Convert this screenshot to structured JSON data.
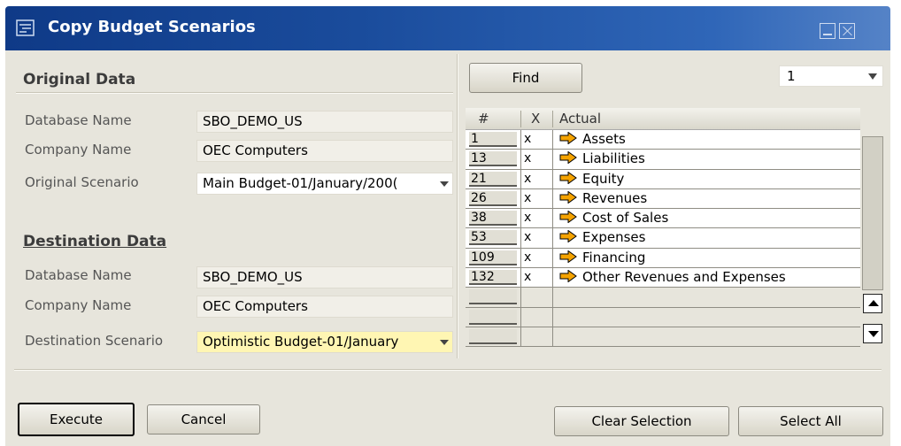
{
  "window": {
    "title": "Copy Budget Scenarios",
    "colors": {
      "titlebar": "#1a4c9c",
      "panel": "#e7e5dc",
      "highlight_field": "#fff6b3"
    }
  },
  "original": {
    "section_title": "Original Data",
    "database_label": "Database Name",
    "database_value": "SBO_DEMO_US",
    "company_label": "Company Name",
    "company_value": "OEC Computers",
    "scenario_label": "Original Scenario",
    "scenario_value": "Main Budget-01/January/200("
  },
  "destination": {
    "section_title": "Destination Data",
    "database_label": "Database Name",
    "database_value": "SBO_DEMO_US",
    "company_label": "Company Name",
    "company_value": "OEC Computers",
    "scenario_label": "Destination Scenario",
    "scenario_value": "Optimistic Budget-01/January"
  },
  "find": {
    "button_label": "Find",
    "page_value": "1"
  },
  "grid": {
    "headers": {
      "num": "#",
      "x": "X",
      "actual": "Actual"
    },
    "rows": [
      {
        "num": "1",
        "x": "x",
        "name": "Assets"
      },
      {
        "num": "13",
        "x": "x",
        "name": "Liabilities"
      },
      {
        "num": "21",
        "x": "x",
        "name": "Equity"
      },
      {
        "num": "26",
        "x": "x",
        "name": "Revenues"
      },
      {
        "num": "38",
        "x": "x",
        "name": "Cost of Sales"
      },
      {
        "num": "53",
        "x": "x",
        "name": "Expenses"
      },
      {
        "num": "109",
        "x": "x",
        "name": "Financing"
      },
      {
        "num": "132",
        "x": "x",
        "name": "Other Revenues and Expenses"
      }
    ],
    "row_icon": "orange-arrow-icon",
    "arrow_color": "#f5a300"
  },
  "buttons": {
    "execute": "Execute",
    "cancel": "Cancel",
    "clear_selection": "Clear Selection",
    "select_all": "Select All"
  }
}
